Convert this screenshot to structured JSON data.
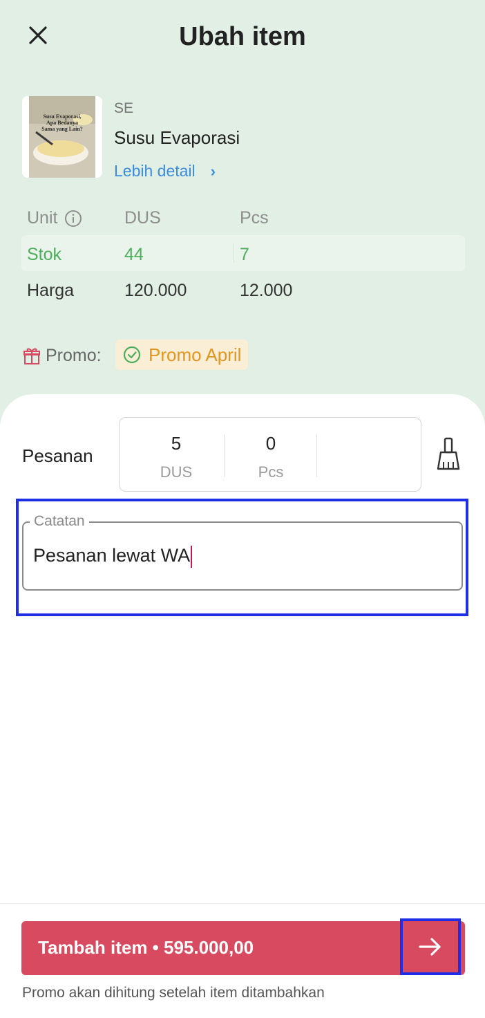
{
  "header": {
    "title": "Ubah item",
    "close_icon": "close-icon"
  },
  "product": {
    "image_text": "Susu Evaporasi, Apa Bedanya Sama yang Lain?",
    "code": "SE",
    "name": "Susu Evaporasi",
    "detail_link": "Lebih detail",
    "detail_icon": "chevron-right-icon"
  },
  "units_table": {
    "unit_label": "Unit",
    "info_icon": "info-icon",
    "columns": [
      "DUS",
      "Pcs"
    ],
    "stock": {
      "label": "Stok",
      "values": [
        "44",
        "7"
      ]
    },
    "price": {
      "label": "Harga",
      "values": [
        "120.000",
        "12.000"
      ]
    }
  },
  "promo": {
    "label": "Promo:",
    "icon": "gift-icon",
    "chip": "Promo April",
    "chip_icon": "check-circle-icon"
  },
  "order": {
    "label": "Pesanan",
    "quantities": [
      {
        "value": "5",
        "unit": "DUS"
      },
      {
        "value": "0",
        "unit": "Pcs"
      }
    ],
    "clear_icon": "broom-icon"
  },
  "note": {
    "legend": "Catatan",
    "value": "Pesanan lewat WA"
  },
  "cta": {
    "label": "Tambah item • 595.000,00",
    "icon": "arrow-right-icon"
  },
  "footnote": "Promo akan dihitung setelah item ditambahkan",
  "colors": {
    "top_bg": "#e1efe5",
    "accent_green": "#4cae5a",
    "cta_red": "#d74a5f",
    "link_blue": "#3b8be0",
    "promo_orange": "#e3961e"
  }
}
